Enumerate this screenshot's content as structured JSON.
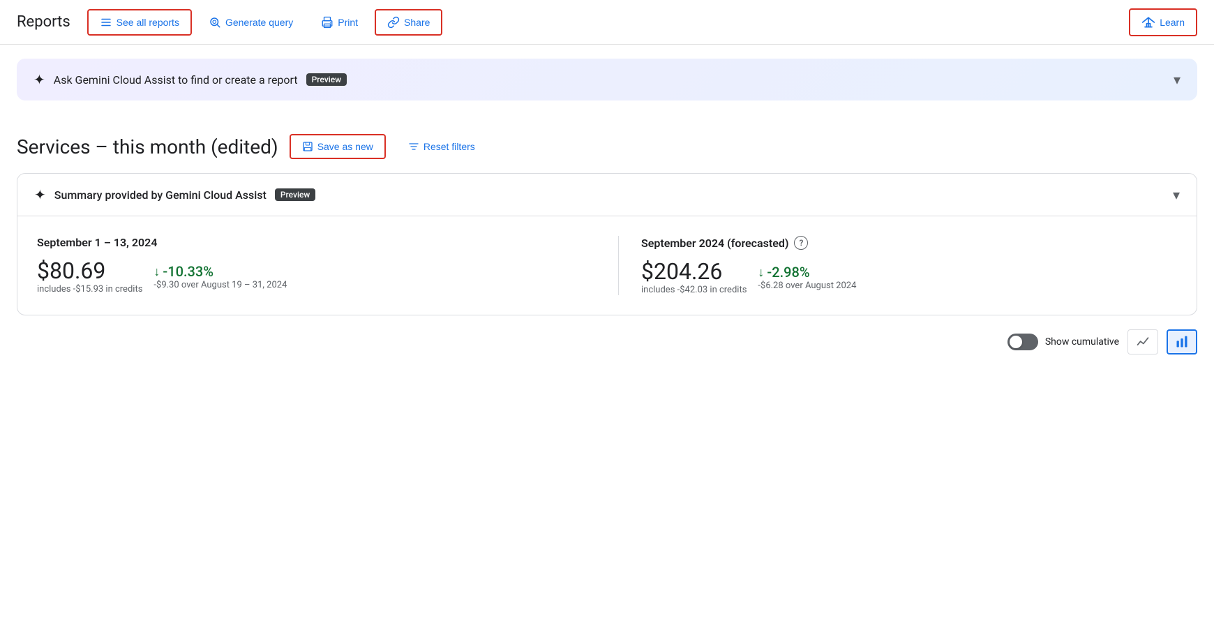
{
  "header": {
    "title": "Reports",
    "see_all_reports_label": "See all reports",
    "generate_query_label": "Generate query",
    "print_label": "Print",
    "share_label": "Share",
    "learn_label": "Learn"
  },
  "gemini_banner": {
    "text": "Ask Gemini Cloud Assist to find or create a report",
    "preview_badge": "Preview"
  },
  "report_title": "Services – this month (edited)",
  "save_as_new_label": "Save as new",
  "reset_filters_label": "Reset filters",
  "summary_card": {
    "title": "Summary provided by Gemini Cloud Assist",
    "preview_badge": "Preview",
    "left": {
      "period": "September 1 – 13, 2024",
      "amount": "$80.69",
      "credits_note": "includes -$15.93 in credits",
      "change_pct": "-10.33%",
      "change_desc": "-$9.30 over August 19 – 31, 2024"
    },
    "right": {
      "period": "September 2024 (forecasted)",
      "amount": "$204.26",
      "credits_note": "includes -$42.03 in credits",
      "change_pct": "-2.98%",
      "change_desc": "-$6.28 over August 2024"
    }
  },
  "show_cumulative_label": "Show cumulative",
  "chart_icons": {
    "line_icon": "〜",
    "bar_icon": "▐"
  }
}
